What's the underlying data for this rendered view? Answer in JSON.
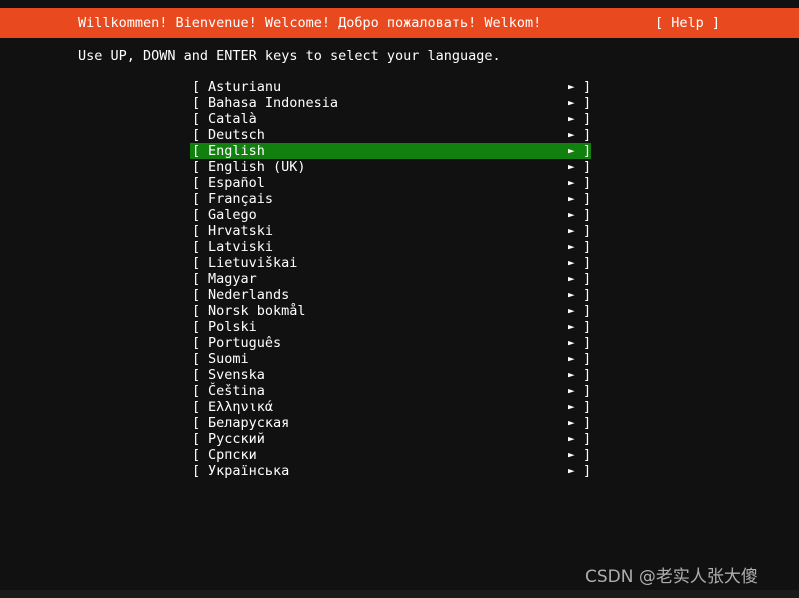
{
  "header": {
    "title": "Willkommen! Bienvenue! Welcome! Добро пожаловать! Welkom!",
    "help_label": "[ Help ]",
    "background_color": "#e8491e",
    "text_color": "#ffffff"
  },
  "instruction": {
    "text": "Use UP, DOWN and ENTER keys to select your language."
  },
  "screen": {
    "background_color": "#111111",
    "selection_color": "#12800f",
    "selected_index": 4
  },
  "list": {
    "open_bracket": "[",
    "close_bracket": "]",
    "arrow_icon": "►",
    "items": [
      {
        "label": "Asturianu",
        "selected": false
      },
      {
        "label": "Bahasa Indonesia",
        "selected": false
      },
      {
        "label": "Català",
        "selected": false
      },
      {
        "label": "Deutsch",
        "selected": false
      },
      {
        "label": "English",
        "selected": true
      },
      {
        "label": "English (UK)",
        "selected": false
      },
      {
        "label": "Español",
        "selected": false
      },
      {
        "label": "Français",
        "selected": false
      },
      {
        "label": "Galego",
        "selected": false
      },
      {
        "label": "Hrvatski",
        "selected": false
      },
      {
        "label": "Latviski",
        "selected": false
      },
      {
        "label": "Lietuviškai",
        "selected": false
      },
      {
        "label": "Magyar",
        "selected": false
      },
      {
        "label": "Nederlands",
        "selected": false
      },
      {
        "label": "Norsk bokmål",
        "selected": false
      },
      {
        "label": "Polski",
        "selected": false
      },
      {
        "label": "Português",
        "selected": false
      },
      {
        "label": "Suomi",
        "selected": false
      },
      {
        "label": "Svenska",
        "selected": false
      },
      {
        "label": "Čeština",
        "selected": false
      },
      {
        "label": "Ελληνικά",
        "selected": false
      },
      {
        "label": "Беларуская",
        "selected": false
      },
      {
        "label": "Русский",
        "selected": false
      },
      {
        "label": "Српски",
        "selected": false
      },
      {
        "label": "Українська",
        "selected": false
      }
    ]
  },
  "watermark": {
    "text": "CSDN @老实人张大傻"
  }
}
